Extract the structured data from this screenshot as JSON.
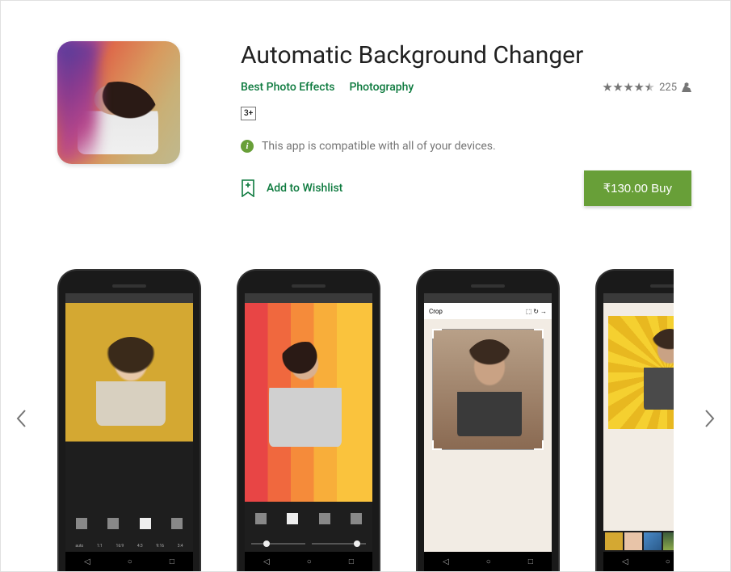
{
  "app": {
    "title": "Automatic Background Changer",
    "developer": "Best Photo Effects",
    "category": "Photography",
    "age_rating": "3+",
    "rating_count": "225",
    "compatibility": "This app is compatible with all of your devices.",
    "wishlist_label": "Add to Wishlist",
    "buy_label": "₹130.00 Buy"
  },
  "screenshots": {
    "crop_label": "Crop",
    "ratios": [
      "auto",
      "1:1",
      "16:9",
      "4:3",
      "9:16",
      "3:4"
    ]
  }
}
